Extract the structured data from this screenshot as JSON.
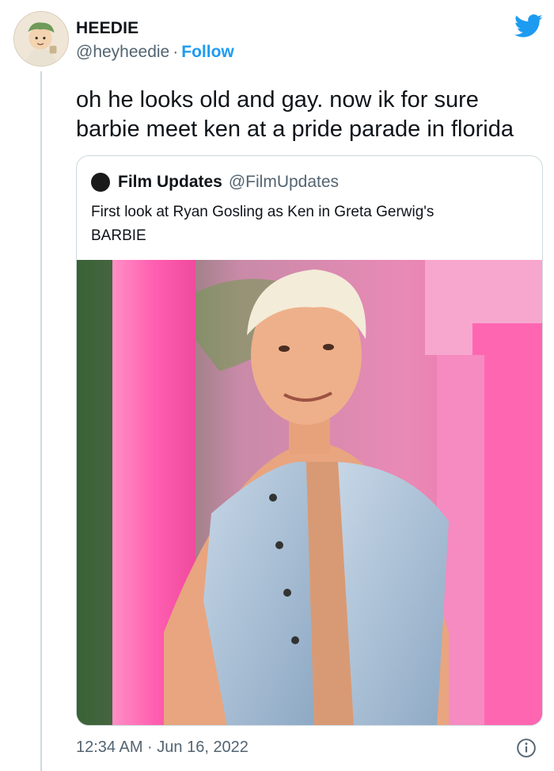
{
  "author": {
    "display_name": "HEEDIE",
    "handle": "@heyheedie",
    "separator": "·",
    "follow_label": "Follow"
  },
  "tweet": {
    "text_line1": "oh he looks old and gay. now ik for sure",
    "text_line2": "barbie meet ken at a pride parade in florida",
    "timestamp": "12:34 AM · Jun 16, 2022"
  },
  "quoted_tweet": {
    "display_name": "Film Updates",
    "handle": "@FilmUpdates",
    "text_line1": "First look at Ryan Gosling as Ken in Greta Gerwig's",
    "text_line2": "BARBIE"
  },
  "icons": {
    "brand": "twitter-bird-icon",
    "info": "info-icon"
  },
  "colors": {
    "accent": "#1d9bf0",
    "text": "#0f1419",
    "secondary_text": "#536471",
    "border": "#cfd9de"
  }
}
